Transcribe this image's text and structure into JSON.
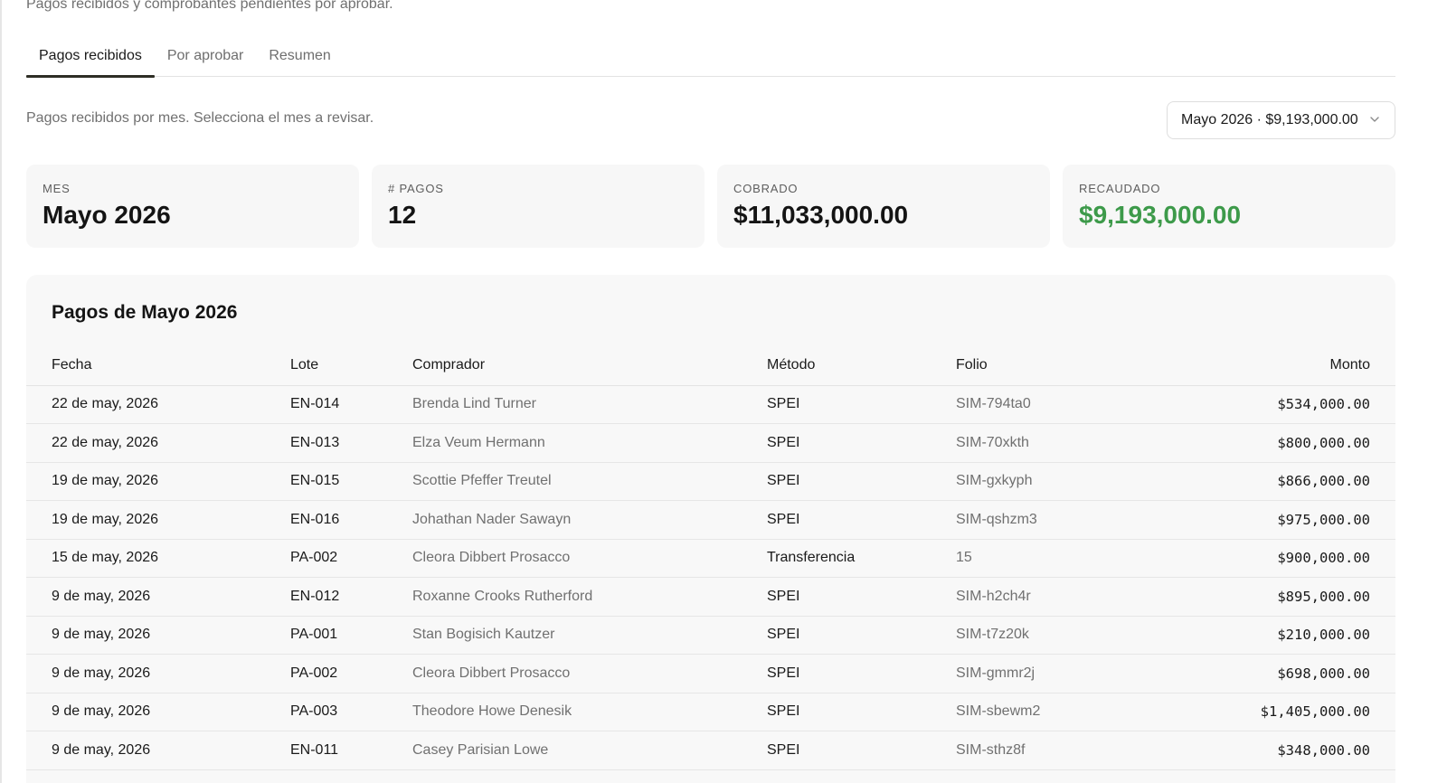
{
  "header": {
    "subtitle": "Pagos recibidos y comprobantes pendientes por aprobar."
  },
  "tabs": [
    {
      "label": "Pagos recibidos",
      "active": true
    },
    {
      "label": "Por aprobar",
      "active": false
    },
    {
      "label": "Resumen",
      "active": false
    }
  ],
  "filter": {
    "hint": "Pagos recibidos por mes. Selecciona el mes a revisar.",
    "selected_month": "Mayo 2026 · $9,193,000.00",
    "chevron_icon": "chevron-down-icon"
  },
  "cards": [
    {
      "label": "MES",
      "value": "Mayo 2026"
    },
    {
      "label": "# PAGOS",
      "value": "12"
    },
    {
      "label": "COBRADO",
      "value": "$11,033,000.00"
    },
    {
      "label": "RECAUDADO",
      "value": "$9,193,000.00"
    }
  ],
  "colors": {
    "recaudado": "#3d9a4a",
    "tab_indicator": "#2e2e25"
  },
  "table": {
    "title": "Pagos de Mayo 2026",
    "columns": [
      "Fecha",
      "Lote",
      "Comprador",
      "Método",
      "Folio",
      "Monto"
    ],
    "rows": [
      {
        "fecha": "22 de may, 2026",
        "lote": "EN-014",
        "comprador": "Brenda Lind Turner",
        "metodo": "SPEI",
        "folio": "SIM-794ta0",
        "monto": "$534,000.00"
      },
      {
        "fecha": "22 de may, 2026",
        "lote": "EN-013",
        "comprador": "Elza Veum Hermann",
        "metodo": "SPEI",
        "folio": "SIM-70xkth",
        "monto": "$800,000.00"
      },
      {
        "fecha": "19 de may, 2026",
        "lote": "EN-015",
        "comprador": "Scottie Pfeffer Treutel",
        "metodo": "SPEI",
        "folio": "SIM-gxkyph",
        "monto": "$866,000.00"
      },
      {
        "fecha": "19 de may, 2026",
        "lote": "EN-016",
        "comprador": "Johathan Nader Sawayn",
        "metodo": "SPEI",
        "folio": "SIM-qshzm3",
        "monto": "$975,000.00"
      },
      {
        "fecha": "15 de may, 2026",
        "lote": "PA-002",
        "comprador": "Cleora Dibbert Prosacco",
        "metodo": "Transferencia",
        "folio": "15",
        "monto": "$900,000.00"
      },
      {
        "fecha": "9 de may, 2026",
        "lote": "EN-012",
        "comprador": "Roxanne Crooks Rutherford",
        "metodo": "SPEI",
        "folio": "SIM-h2ch4r",
        "monto": "$895,000.00"
      },
      {
        "fecha": "9 de may, 2026",
        "lote": "PA-001",
        "comprador": "Stan Bogisich Kautzer",
        "metodo": "SPEI",
        "folio": "SIM-t7z20k",
        "monto": "$210,000.00"
      },
      {
        "fecha": "9 de may, 2026",
        "lote": "PA-002",
        "comprador": "Cleora Dibbert Prosacco",
        "metodo": "SPEI",
        "folio": "SIM-gmmr2j",
        "monto": "$698,000.00"
      },
      {
        "fecha": "9 de may, 2026",
        "lote": "PA-003",
        "comprador": "Theodore Howe Denesik",
        "metodo": "SPEI",
        "folio": "SIM-sbewm2",
        "monto": "$1,405,000.00"
      },
      {
        "fecha": "9 de may, 2026",
        "lote": "EN-011",
        "comprador": "Casey Parisian Lowe",
        "metodo": "SPEI",
        "folio": "SIM-sthz8f",
        "monto": "$348,000.00"
      }
    ]
  }
}
